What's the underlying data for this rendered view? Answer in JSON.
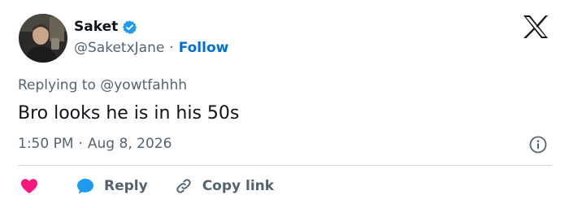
{
  "author": {
    "name": "Saket",
    "handle": "@SaketxJane",
    "separator": "·",
    "follow_label": "Follow"
  },
  "reply_context": {
    "prefix": "Replying to",
    "target_handle": "@yowtfahhh"
  },
  "tweet": {
    "text": "Bro looks he is in his 50s"
  },
  "meta": {
    "time": "1:50 PM",
    "separator": "·",
    "date": "Aug 8, 2026"
  },
  "actions": {
    "reply_label": "Reply",
    "copy_link_label": "Copy link"
  },
  "icons": {
    "logo": "x-logo-icon",
    "verified": "verified-badge-icon",
    "info": "info-icon",
    "like": "heart-icon",
    "reply": "speech-bubble-icon",
    "copy": "link-icon"
  },
  "colors": {
    "text_primary": "#0f1419",
    "text_secondary": "#536471",
    "link": "#006fd6",
    "verified": "#1d9bf0",
    "like": "#f91880",
    "reply": "#1d9bf0",
    "divider": "#cfd9de"
  }
}
